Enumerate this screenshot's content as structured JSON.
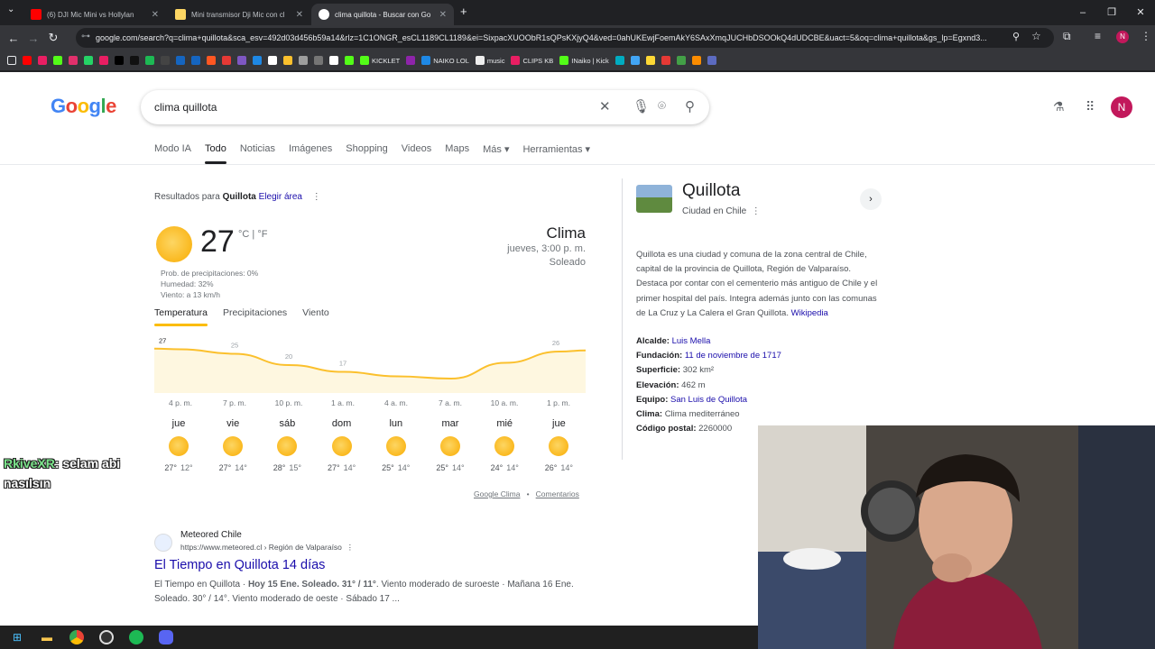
{
  "browser": {
    "tabs": [
      {
        "label": "(6) DJI Mic Mini vs Hollylan",
        "icon": "youtube-icon",
        "close": "✕"
      },
      {
        "label": "Mini transmisor Dji Mic con cl",
        "icon": "page-icon",
        "close": "✕"
      },
      {
        "label": "clima quillota - Buscar con Go",
        "icon": "google-icon",
        "close": "✕"
      }
    ],
    "new_tab": "+",
    "url": "google.com/search?q=clima+quillota&sca_esv=492d03d456b59a14&rlz=1C1ONGR_esCL1189CL1189&ei=SixpacXUOObR1sQPsKXjyQ4&ved=0ahUKEwjFoemAkY6SAxXmqJUCHbDSOOkQ4dUDCBE&uact=5&oq=clima+quillota&gs_lp=Egxnd3...",
    "avatar_letter": "N",
    "bookmarks": [
      {
        "label": "",
        "color": "#ff0000"
      },
      {
        "label": "",
        "color": "#e91e63"
      },
      {
        "label": "",
        "color": "#53fc18"
      },
      {
        "label": "",
        "color": "#e1306c"
      },
      {
        "label": "",
        "color": "#25d366"
      },
      {
        "label": "",
        "color": "#e91e63"
      },
      {
        "label": "",
        "color": "#000000"
      },
      {
        "label": "",
        "color": "#111111"
      },
      {
        "label": "",
        "color": "#1db954"
      },
      {
        "label": "",
        "color": "#444444"
      },
      {
        "label": "",
        "color": "#1565c0"
      },
      {
        "label": "",
        "color": "#1565c0"
      },
      {
        "label": "",
        "color": "#ff5722"
      },
      {
        "label": "",
        "color": "#e53935"
      },
      {
        "label": "",
        "color": "#7e57c2"
      },
      {
        "label": "",
        "color": "#1e88e5"
      },
      {
        "label": "",
        "color": "#ffffff"
      },
      {
        "label": "",
        "color": "#fbc02d"
      },
      {
        "label": "",
        "color": "#9e9e9e"
      },
      {
        "label": "",
        "color": "#757575"
      },
      {
        "label": "",
        "color": "#ffffff"
      },
      {
        "label": "",
        "color": "#53fc18"
      },
      {
        "label": "KICKLET",
        "color": "#53fc18"
      },
      {
        "label": "",
        "color": "#8e24aa"
      },
      {
        "label": "NAIKO LOL",
        "color": "#1e88e5"
      },
      {
        "label": "music",
        "color": "#eeeeee"
      },
      {
        "label": "CLIPS KB",
        "color": "#e91e63"
      },
      {
        "label": "INaiko | Kick",
        "color": "#53fc18"
      },
      {
        "label": "",
        "color": "#00acc1"
      },
      {
        "label": "",
        "color": "#42a5f5"
      },
      {
        "label": "",
        "color": "#fdd835"
      },
      {
        "label": "",
        "color": "#e53935"
      },
      {
        "label": "",
        "color": "#43a047"
      },
      {
        "label": "",
        "color": "#fb8c00"
      },
      {
        "label": "",
        "color": "#5c6bc0"
      }
    ]
  },
  "google": {
    "logo": "Google",
    "query": "clima quillota",
    "nav": [
      "Modo IA",
      "Todo",
      "Noticias",
      "Imágenes",
      "Shopping",
      "Videos",
      "Maps",
      "Más ▾",
      "Herramientas ▾"
    ],
    "active_nav": 1
  },
  "weather": {
    "results_for": "Resultados para",
    "place": "Quillota",
    "change_area": "Elegir área",
    "temp": "27",
    "units": "°C | °F",
    "precip": "Prob. de precipitaciones: 0%",
    "humidity": "Humedad: 32%",
    "wind": "Viento: a 13 km/h",
    "heading": "Clima",
    "datetime": "jueves, 3:00 p. m.",
    "condition": "Soleado",
    "tabs": [
      "Temperatura",
      "Precipitaciones",
      "Viento"
    ],
    "hours": [
      "4 p. m.",
      "7 p. m.",
      "10 p. m.",
      "1 a. m.",
      "4 a. m.",
      "7 a. m.",
      "10 a. m.",
      "1 p. m."
    ],
    "days": [
      {
        "name": "jue",
        "max": "27°",
        "min": "12°"
      },
      {
        "name": "vie",
        "max": "27°",
        "min": "14°"
      },
      {
        "name": "sáb",
        "max": "28°",
        "min": "15°"
      },
      {
        "name": "dom",
        "max": "27°",
        "min": "14°"
      },
      {
        "name": "lun",
        "max": "25°",
        "min": "14°"
      },
      {
        "name": "mar",
        "max": "25°",
        "min": "14°"
      },
      {
        "name": "mié",
        "max": "24°",
        "min": "14°"
      },
      {
        "name": "jue",
        "max": "26°",
        "min": "14°"
      }
    ],
    "source": "Google Clima",
    "feedback": "Comentarios"
  },
  "chart_data": {
    "type": "area",
    "title": "",
    "x": [
      "4 p. m.",
      "7 p. m.",
      "10 p. m.",
      "1 a. m.",
      "4 a. m.",
      "7 a. m.",
      "10 a. m.",
      "1 p. m."
    ],
    "series": [
      {
        "values": [
          27,
          25,
          20,
          17,
          15,
          14,
          21,
          26
        ]
      }
    ],
    "labels": [
      {
        "index": 0,
        "text": "27"
      },
      {
        "index": 1,
        "text": "25"
      },
      {
        "index": 2,
        "text": "20"
      },
      {
        "index": 3,
        "text": "17"
      },
      {
        "index": 7,
        "text": "26"
      }
    ],
    "ylim": [
      10,
      30
    ],
    "colors": {
      "line": "#fbc02d",
      "fill": "#fef7e0"
    }
  },
  "result": {
    "site": "Meteored Chile",
    "url": "https://www.meteored.cl › Región de Valparaíso",
    "title": "El Tiempo en Quillota 14 días",
    "snippet_a": "El Tiempo en Quillota · ",
    "snippet_b": "Hoy 15 Ene. Soleado. 31° / 11°",
    "snippet_c": ". Viento moderado de suroeste · Mañana 16 Ene. Soleado. 30° / 14°. Viento moderado de oeste · Sábado 17 ..."
  },
  "knowledge": {
    "title": "Quillota",
    "subtitle": "Ciudad en Chile",
    "description": "Quillota es una ciudad y comuna de la zona central de Chile, capital de la provincia de Quillota, Región de Valparaíso. Destaca por contar con el cementerio más antiguo de Chile y el primer hospital del país. Integra además junto con las comunas de La Cruz y La Calera el Gran Quillota.",
    "wiki": "Wikipedia",
    "facts": [
      {
        "k": "Alcalde:",
        "v": "Luis Mella",
        "link": true
      },
      {
        "k": "Fundación:",
        "v": "11 de noviembre de 1717",
        "link": true
      },
      {
        "k": "Superficie:",
        "v": "302 km²",
        "link": false
      },
      {
        "k": "Elevación:",
        "v": "462 m",
        "link": false
      },
      {
        "k": "Equipo:",
        "v": "San Luis de Quillota",
        "link": true
      },
      {
        "k": "Clima:",
        "v": "Clima mediterráneo",
        "link": false
      },
      {
        "k": "Código postal:",
        "v": "2260000",
        "link": false
      }
    ]
  },
  "overlay": {
    "chat_user": "RkiveXR",
    "chat_msg": ": selam abi nasılsın"
  }
}
